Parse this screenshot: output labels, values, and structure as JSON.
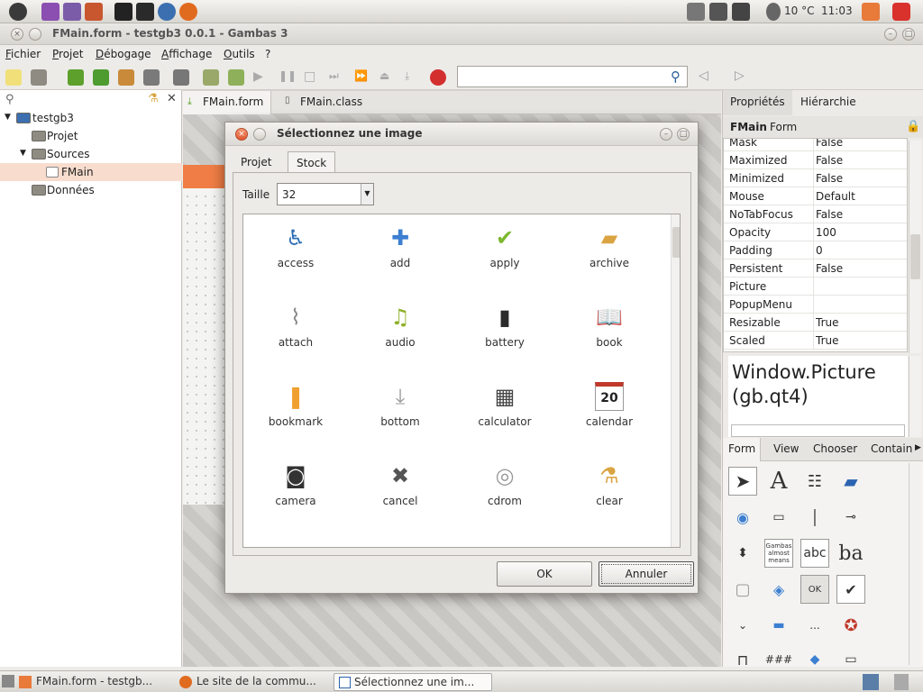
{
  "system": {
    "weather": "10 °C",
    "clock": "11:03"
  },
  "window": {
    "title": "FMain.form - testgb3 0.0.1 - Gambas 3"
  },
  "menu": {
    "items": [
      "Fichier",
      "Projet",
      "Débogage",
      "Affichage",
      "Outils",
      "?"
    ]
  },
  "tree": {
    "root": "testgb3",
    "items": [
      {
        "label": "Projet"
      },
      {
        "label": "Sources"
      },
      {
        "label": "FMain"
      },
      {
        "label": "Données"
      }
    ]
  },
  "editor": {
    "tabs": [
      "FMain.form",
      "FMain.class"
    ]
  },
  "dialog": {
    "title": "Sélectionnez une image",
    "tabs": [
      "Projet",
      "Stock"
    ],
    "size_label": "Taille",
    "size_value": "32",
    "icons": [
      {
        "name": "access",
        "glyph": "♿",
        "color": "#2e6fb5"
      },
      {
        "name": "add",
        "glyph": "✚",
        "color": "#3d7fd1"
      },
      {
        "name": "apply",
        "glyph": "✔",
        "color": "#7cb82f"
      },
      {
        "name": "archive",
        "glyph": "▰",
        "color": "#d9a441"
      },
      {
        "name": "attach",
        "glyph": "⌇",
        "color": "#8a8a8a"
      },
      {
        "name": "audio",
        "glyph": "♫",
        "color": "#8fb02b"
      },
      {
        "name": "battery",
        "glyph": "▮",
        "color": "#2b2b2b"
      },
      {
        "name": "book",
        "glyph": "📖",
        "color": "#6a5a4a"
      },
      {
        "name": "bookmark",
        "glyph": "❚",
        "color": "#f0a030"
      },
      {
        "name": "bottom",
        "glyph": "⤓",
        "color": "#9a9a9a"
      },
      {
        "name": "calculator",
        "glyph": "▦",
        "color": "#444444"
      },
      {
        "name": "calendar",
        "glyph": "20",
        "color": "#c0392b"
      },
      {
        "name": "camera",
        "glyph": "◙",
        "color": "#333333"
      },
      {
        "name": "cancel",
        "glyph": "✖",
        "color": "#555555"
      },
      {
        "name": "cdrom",
        "glyph": "◎",
        "color": "#9a9a9a"
      },
      {
        "name": "clear",
        "glyph": "⚗",
        "color": "#d9a441"
      }
    ],
    "ok_label": "OK",
    "cancel_label": "Annuler"
  },
  "properties": {
    "tabs": [
      "Propriétés",
      "Hiérarchie"
    ],
    "header_name": "FMain",
    "header_type": "Form",
    "rows": [
      {
        "name": "Mask",
        "value": "False"
      },
      {
        "name": "Maximized",
        "value": "False"
      },
      {
        "name": "Minimized",
        "value": "False"
      },
      {
        "name": "Mouse",
        "value": "Default"
      },
      {
        "name": "NoTabFocus",
        "value": "False"
      },
      {
        "name": "Opacity",
        "value": "100"
      },
      {
        "name": "Padding",
        "value": "0"
      },
      {
        "name": "Persistent",
        "value": "False"
      },
      {
        "name": "Picture",
        "value": ""
      },
      {
        "name": "PopupMenu",
        "value": ""
      },
      {
        "name": "Resizable",
        "value": "True"
      },
      {
        "name": "Scaled",
        "value": "True"
      }
    ],
    "help_title": "Window.Picture (gb.qt4)"
  },
  "toolbox": {
    "tabs": [
      "Form",
      "View",
      "Chooser",
      "Contain"
    ],
    "label_tool": "A",
    "textbox_tool": "abc",
    "button_tool": "OK",
    "check_tool": "✔",
    "label_sample": "Gambas almost means",
    "grid_tool": "###",
    "combo_tool": "..."
  },
  "taskbar": {
    "items": [
      "FMain.form - testgb...",
      "Le site de la commu...",
      "Sélectionnez une im..."
    ]
  }
}
